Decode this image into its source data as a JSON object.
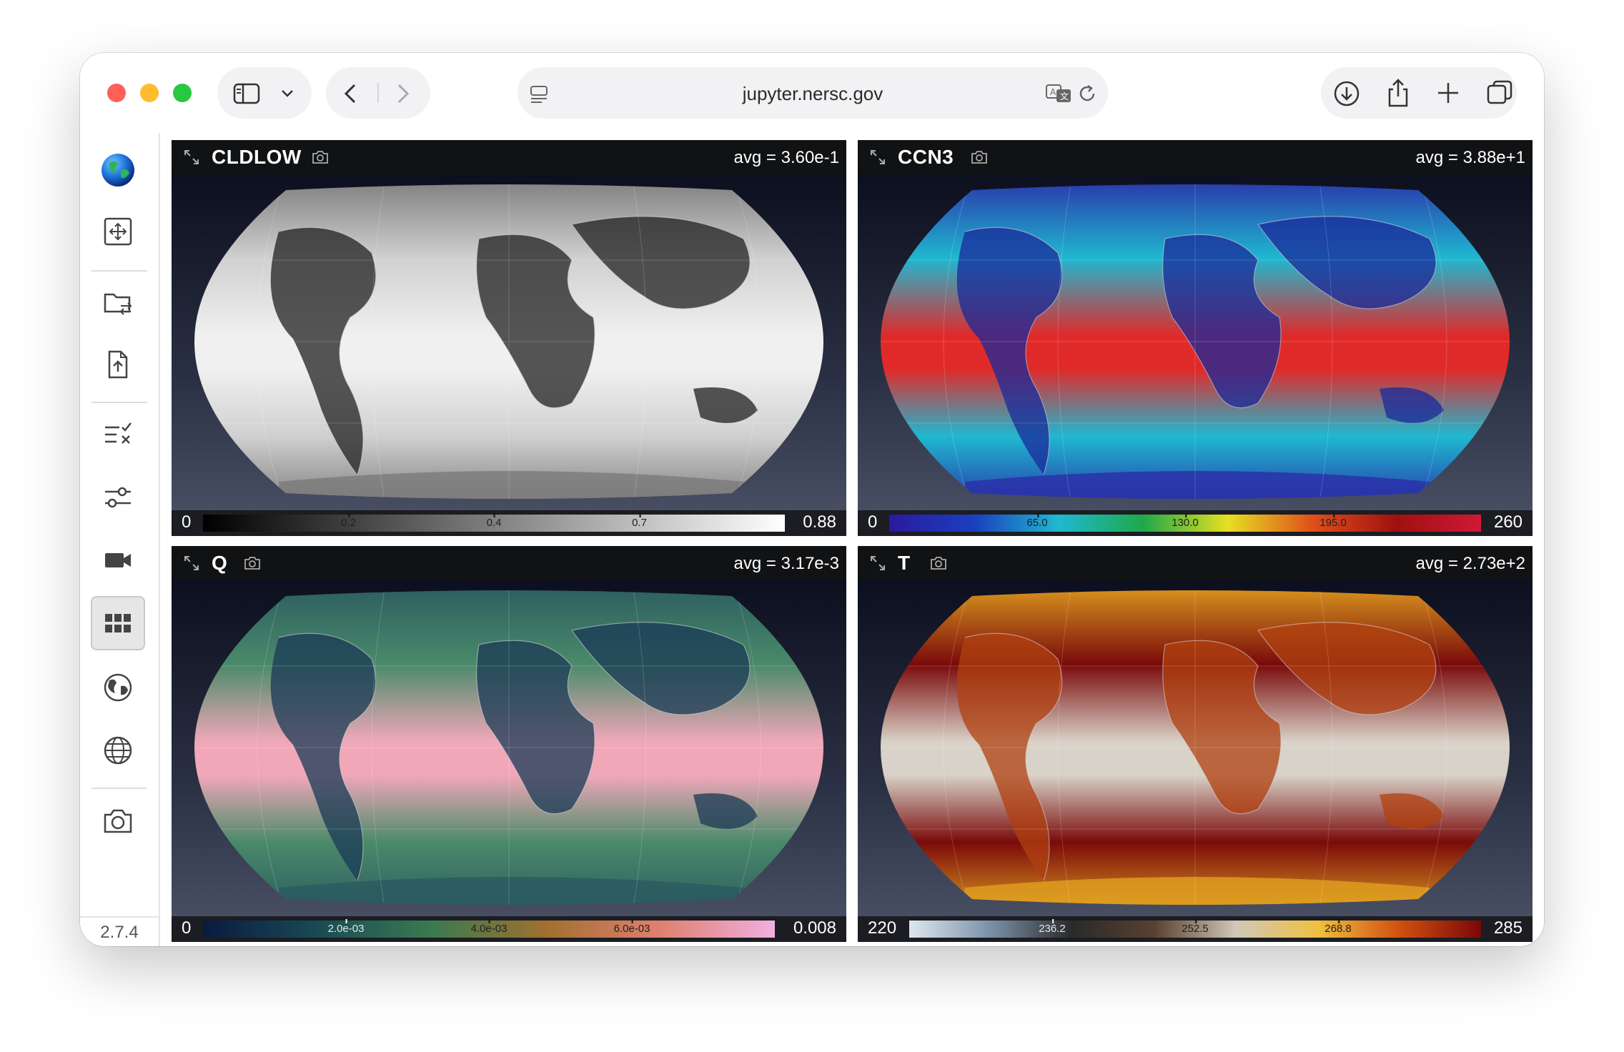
{
  "browser": {
    "url": "jupyter.nersc.gov",
    "traffic_light_colors": [
      "#ff5f57",
      "#febc2e",
      "#28c840"
    ]
  },
  "sidebar": {
    "version": "2.7.4",
    "items": [
      {
        "name": "app-logo",
        "icon": "globe-color-icon"
      },
      {
        "name": "layout",
        "icon": "move-frame-icon"
      },
      {
        "name": "file-browser",
        "icon": "folder-swap-icon"
      },
      {
        "name": "file-upload",
        "icon": "file-upload-icon"
      },
      {
        "name": "field-selection",
        "icon": "list-check-icon"
      },
      {
        "name": "controls",
        "icon": "sliders-icon"
      },
      {
        "name": "animation",
        "icon": "video-camera-icon"
      },
      {
        "name": "grid-layout",
        "icon": "grid-icon",
        "active": true
      },
      {
        "name": "projection",
        "icon": "globe-filled-icon"
      },
      {
        "name": "globe-view",
        "icon": "globe-outline-icon"
      },
      {
        "name": "screenshot",
        "icon": "camera-icon"
      }
    ]
  },
  "panels": [
    {
      "title": "CLDLOW",
      "avg": "avg = 3.60e-1",
      "colorbar": {
        "min": "0",
        "max": "0.88",
        "ticks": [
          "0.2",
          "0.4",
          "0.7"
        ],
        "tick_positions": [
          0.25,
          0.5,
          0.75
        ],
        "colors": [
          "#000000",
          "#555555",
          "#aaaaaa",
          "#ffffff"
        ],
        "light_ticks": false
      },
      "map_colors": {
        "land": "#202020",
        "ocean_a": "#7a7a7a",
        "ocean_b": "#d0d0d0",
        "band": "#f0f0f0"
      }
    },
    {
      "title": "CCN3",
      "avg": "avg = 3.88e+1",
      "colorbar": {
        "min": "0",
        "max": "260",
        "ticks": [
          "65.0",
          "130.0",
          "195.0"
        ],
        "tick_positions": [
          0.25,
          0.5,
          0.75
        ],
        "colors": [
          "#2a1a9e",
          "#1a3fbf",
          "#1fb8d0",
          "#1fa84a",
          "#e6e020",
          "#e0501a",
          "#a01010",
          "#d01838"
        ],
        "light_ticks": false
      },
      "map_colors": {
        "land": "#1a2a9a",
        "ocean_a": "#2a2ea8",
        "ocean_b": "#1fb8d0",
        "band": "#e02a2a"
      }
    },
    {
      "title": "Q",
      "avg": "avg = 3.17e-3",
      "colorbar": {
        "min": "0",
        "max": "0.008",
        "ticks": [
          "2.0e-03",
          "4.0e-03",
          "6.0e-03"
        ],
        "tick_positions": [
          0.25,
          0.5,
          0.75
        ],
        "colors": [
          "#0a1a40",
          "#1a4a55",
          "#3a7a50",
          "#a07030",
          "#e08070",
          "#f0b0e0"
        ],
        "light_ticks": true
      },
      "map_colors": {
        "land": "#1a3a55",
        "ocean_a": "#2a5a60",
        "ocean_b": "#4a8a6a",
        "band": "#f0a8b8"
      }
    },
    {
      "title": "T",
      "avg": "avg = 2.73e+2",
      "colorbar": {
        "min": "220",
        "max": "285",
        "ticks": [
          "236.2",
          "252.5",
          "268.8"
        ],
        "tick_positions": [
          0.25,
          0.5,
          0.75
        ],
        "colors": [
          "#dde6ee",
          "#7a90a8",
          "#2a2a2a",
          "#5a4030",
          "#d0c8b8",
          "#f0c040",
          "#d05010",
          "#7a0808"
        ],
        "light_ticks": true
      },
      "map_colors": {
        "land": "#b04010",
        "ocean_a": "#e0a020",
        "ocean_b": "#7a0a0a",
        "band": "#d8d2c8"
      }
    }
  ]
}
